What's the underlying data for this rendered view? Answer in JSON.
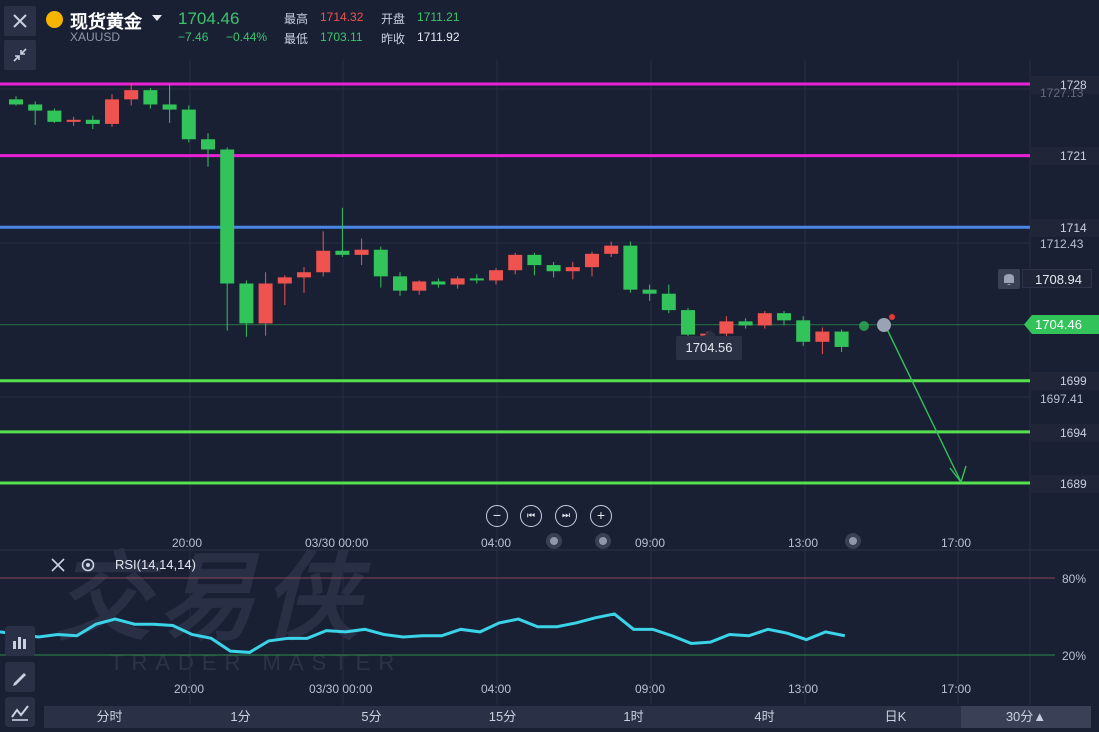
{
  "instrument": {
    "name": "现货黄金",
    "symbol": "XAUUSD",
    "price": "1704.46",
    "change": "−7.46",
    "change_pct": "−0.44%",
    "high_label": "最高",
    "high": "1714.32",
    "open_label": "开盘",
    "open": "1711.21",
    "low_label": "最低",
    "low": "1703.11",
    "prev_close_label": "昨收",
    "prev_close": "1711.92"
  },
  "levels": [
    {
      "value": "1728",
      "color": "#ea1fd6"
    },
    {
      "value": "1721",
      "color": "#ea1fd6"
    },
    {
      "value": "1714",
      "color": "#4a86e8"
    },
    {
      "value": "1699",
      "color": "#55e04e"
    },
    {
      "value": "1694",
      "color": "#55e04e"
    },
    {
      "value": "1689",
      "color": "#55e04e"
    }
  ],
  "price_axis": {
    "tick_top": "1727.13",
    "tick_upper": "1712.43",
    "tick_lower": "1697.41",
    "alert_price": "1708.94",
    "current_price": "1704.46"
  },
  "tooltip_value": "1704.56",
  "time_axis": [
    "20:00",
    "03/30 00:00",
    "04:00",
    "09:00",
    "13:00",
    "17:00"
  ],
  "navigation": {
    "zoom_out": "−",
    "prev": "⏮",
    "next": "⏭",
    "zoom_in": "+"
  },
  "rsi": {
    "label": "RSI(14,14,14)",
    "level_high": "80%",
    "level_low": "20%",
    "color": "#3ad3e8"
  },
  "timeframes": [
    "分时",
    "1分",
    "5分",
    "15分",
    "1时",
    "4时",
    "日K",
    "30分▲"
  ],
  "active_timeframe": "30分▲",
  "watermark": {
    "cn": "交易侠",
    "en": "TRADER MASTER"
  },
  "colors": {
    "up": "#ef5350",
    "down": "#32c35a",
    "background": "#1a2034"
  },
  "candles": [
    [
      1726.5,
      1726.8,
      1725.9,
      1726.0
    ],
    [
      1726.0,
      1726.3,
      1724.0,
      1725.4
    ],
    [
      1725.4,
      1725.6,
      1724.2,
      1724.3
    ],
    [
      1724.3,
      1724.8,
      1723.9,
      1724.5
    ],
    [
      1724.5,
      1724.9,
      1723.6,
      1724.1
    ],
    [
      1724.1,
      1727.0,
      1723.8,
      1726.5
    ],
    [
      1726.5,
      1728.1,
      1725.9,
      1727.4
    ],
    [
      1727.4,
      1727.6,
      1725.6,
      1726.0
    ],
    [
      1726.0,
      1728.0,
      1724.2,
      1725.5
    ],
    [
      1725.5,
      1725.9,
      1722.3,
      1722.6
    ],
    [
      1722.6,
      1723.2,
      1719.9,
      1721.6
    ],
    [
      1721.6,
      1721.8,
      1703.9,
      1708.5
    ],
    [
      1708.5,
      1708.8,
      1703.3,
      1704.6
    ],
    [
      1704.6,
      1709.6,
      1703.4,
      1708.5
    ],
    [
      1708.5,
      1709.3,
      1706.4,
      1709.1
    ],
    [
      1709.1,
      1710.1,
      1707.6,
      1709.6
    ],
    [
      1709.6,
      1713.6,
      1709.2,
      1711.7
    ],
    [
      1711.7,
      1715.9,
      1711.1,
      1711.3
    ],
    [
      1711.3,
      1712.9,
      1710.3,
      1711.8
    ],
    [
      1711.8,
      1712.1,
      1708.1,
      1709.2
    ],
    [
      1709.2,
      1709.6,
      1707.3,
      1707.8
    ],
    [
      1707.8,
      1708.8,
      1707.4,
      1708.7
    ],
    [
      1708.7,
      1709.0,
      1708.1,
      1708.4
    ],
    [
      1708.4,
      1709.2,
      1708.0,
      1709.0
    ],
    [
      1709.0,
      1709.4,
      1708.5,
      1708.8
    ],
    [
      1708.8,
      1710.0,
      1708.4,
      1709.8
    ],
    [
      1709.8,
      1711.5,
      1709.4,
      1711.3
    ],
    [
      1711.3,
      1711.5,
      1709.3,
      1710.3
    ],
    [
      1710.3,
      1710.6,
      1709.1,
      1709.7
    ],
    [
      1709.7,
      1710.6,
      1708.9,
      1710.1
    ],
    [
      1710.1,
      1711.6,
      1709.2,
      1711.4
    ],
    [
      1711.4,
      1712.6,
      1711.1,
      1712.2
    ],
    [
      1712.2,
      1712.6,
      1707.6,
      1707.9
    ],
    [
      1707.9,
      1708.4,
      1706.8,
      1707.5
    ],
    [
      1707.5,
      1708.4,
      1705.6,
      1705.9
    ],
    [
      1705.9,
      1706.1,
      1702.9,
      1703.5
    ],
    [
      1703.5,
      1703.8,
      1703.0,
      1703.6
    ],
    [
      1703.6,
      1705.3,
      1703.1,
      1704.8
    ],
    [
      1704.8,
      1705.1,
      1704.1,
      1704.4
    ],
    [
      1704.4,
      1705.8,
      1704.1,
      1705.6
    ],
    [
      1705.6,
      1705.8,
      1704.4,
      1704.9
    ],
    [
      1704.9,
      1705.3,
      1702.4,
      1702.8
    ],
    [
      1702.8,
      1704.2,
      1701.6,
      1703.8
    ],
    [
      1703.8,
      1704.0,
      1701.8,
      1702.3
    ]
  ],
  "rsi_values": [
    38,
    36,
    34,
    36,
    35,
    44,
    48,
    44,
    44,
    43,
    36,
    33,
    23,
    22,
    31,
    33,
    33,
    39,
    38,
    40,
    36,
    34,
    35,
    35,
    40,
    38,
    45,
    48,
    42,
    42,
    45,
    49,
    52,
    40,
    40,
    35,
    29,
    30,
    36,
    35,
    40,
    37,
    32,
    38,
    35
  ]
}
